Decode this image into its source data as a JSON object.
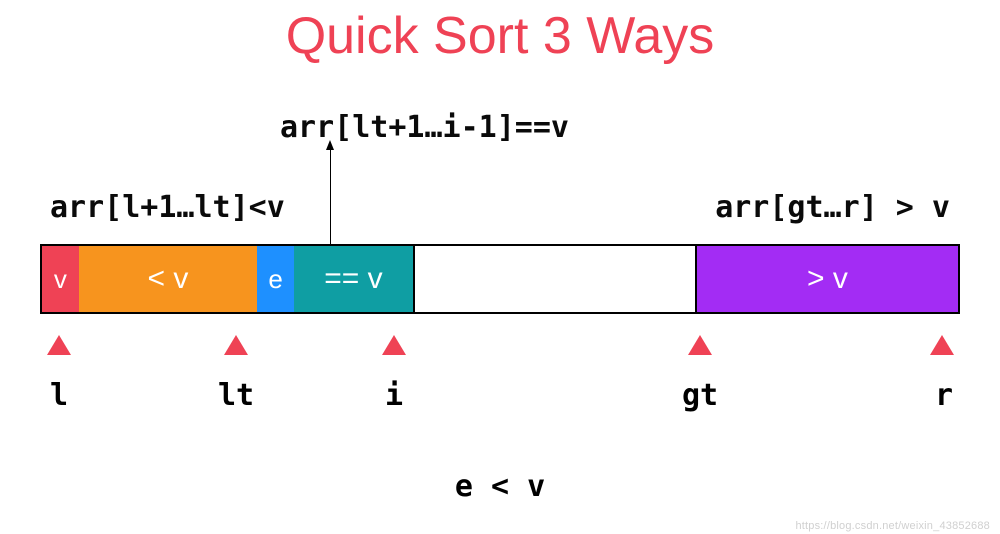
{
  "title": "Quick Sort 3 Ways",
  "annotations": {
    "left": "arr[l+1…lt]<v",
    "middle": "arr[lt+1…i-1]==v",
    "right": "arr[gt…r] > v"
  },
  "bar": {
    "pivot": "v",
    "less": "< v",
    "current": "e",
    "equal": "== v",
    "unseen": "",
    "greater": "> v"
  },
  "pointers": {
    "l": "l",
    "lt": "lt",
    "i": "i",
    "gt": "gt",
    "r": "r"
  },
  "condition": "e < v",
  "watermark": "https://blog.csdn.net/weixin_43852688",
  "colors": {
    "title": "#ef4255",
    "pivot": "#ef4255",
    "less": "#f7941e",
    "current": "#1e90ff",
    "equal": "#0f9ea3",
    "greater": "#a32cf4",
    "pointer": "#ef4255"
  }
}
